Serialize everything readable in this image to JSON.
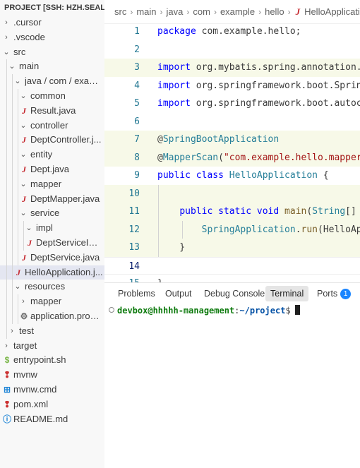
{
  "explorer": {
    "title": "PROJECT [SSH: HZH.SEAL...",
    "items": [
      {
        "label": ".cursor",
        "chevron": "›",
        "depth": 0
      },
      {
        "label": ".vscode",
        "chevron": "›",
        "depth": 0
      },
      {
        "label": "src",
        "chevron": "⌄",
        "depth": 0
      },
      {
        "label": "main",
        "chevron": "⌄",
        "depth": 1
      },
      {
        "label": "java / com / exampl...",
        "chevron": "⌄",
        "depth": 2
      },
      {
        "label": "common",
        "chevron": "⌄",
        "depth": 3
      },
      {
        "label": "Result.java",
        "icon": "J",
        "depth": 3
      },
      {
        "label": "controller",
        "chevron": "⌄",
        "depth": 3
      },
      {
        "label": "DeptController.j...",
        "icon": "J",
        "depth": 3
      },
      {
        "label": "entity",
        "chevron": "⌄",
        "depth": 3
      },
      {
        "label": "Dept.java",
        "icon": "J",
        "depth": 3
      },
      {
        "label": "mapper",
        "chevron": "⌄",
        "depth": 3
      },
      {
        "label": "DeptMapper.java",
        "icon": "J",
        "depth": 3
      },
      {
        "label": "service",
        "chevron": "⌄",
        "depth": 3
      },
      {
        "label": "impl",
        "chevron": "⌄",
        "depth": 4
      },
      {
        "label": "DeptServiceIm...",
        "icon": "J",
        "depth": 4
      },
      {
        "label": "DeptService.java",
        "icon": "J",
        "depth": 3
      },
      {
        "label": "HelloApplication.j...",
        "icon": "J",
        "depth": 2
      },
      {
        "label": "resources",
        "chevron": "⌄",
        "depth": 2
      },
      {
        "label": "mapper",
        "chevron": "›",
        "depth": 3
      },
      {
        "label": "application.prope...",
        "icon": "⚙",
        "depth": 3
      },
      {
        "label": "test",
        "chevron": "›",
        "depth": 1
      },
      {
        "label": "target",
        "chevron": "›",
        "depth": 0
      },
      {
        "label": "entrypoint.sh",
        "icon": "$",
        "depth": 0
      },
      {
        "label": "mvnw",
        "icon": "❢",
        "depth": 0
      },
      {
        "label": "mvnw.cmd",
        "icon": "⊞",
        "depth": 0
      },
      {
        "label": "pom.xml",
        "icon": "❢",
        "depth": 0
      },
      {
        "label": "README.md",
        "icon": "ⓘ",
        "depth": 0
      }
    ]
  },
  "breadcrumb": {
    "parts": [
      "src",
      "main",
      "java",
      "com",
      "example",
      "hello"
    ],
    "file_icon": "J",
    "file": "HelloApplication.java"
  },
  "editor": {
    "lines": [
      {
        "n": "1",
        "tokens": [
          {
            "t": "package",
            "c": "kw"
          },
          {
            "t": " com.example.hello;",
            "c": ""
          }
        ]
      },
      {
        "n": "2",
        "tokens": []
      },
      {
        "n": "3",
        "tokens": [
          {
            "t": "import",
            "c": "kw"
          },
          {
            "t": " org.mybatis.spring.annotation.MapperScan;",
            "c": ""
          }
        ]
      },
      {
        "n": "4",
        "tokens": [
          {
            "t": "import",
            "c": "kw"
          },
          {
            "t": " org.springframework.boot.SpringApplication;",
            "c": ""
          }
        ]
      },
      {
        "n": "5",
        "tokens": [
          {
            "t": "import",
            "c": "kw"
          },
          {
            "t": " org.springframework.boot.autoconfigure.SpringBootApplication;",
            "c": ""
          }
        ]
      },
      {
        "n": "6",
        "tokens": []
      },
      {
        "n": "7",
        "tokens": [
          {
            "t": "@",
            "c": ""
          },
          {
            "t": "SpringBootApplication",
            "c": "an"
          }
        ]
      },
      {
        "n": "8",
        "tokens": [
          {
            "t": "@",
            "c": ""
          },
          {
            "t": "MapperScan",
            "c": "an"
          },
          {
            "t": "(",
            "c": ""
          },
          {
            "t": "\"com.example.hello.mapper\"",
            "c": "str"
          },
          {
            "t": ")",
            "c": ""
          }
        ]
      },
      {
        "n": "9",
        "tokens": [
          {
            "t": "public",
            "c": "kw"
          },
          {
            "t": " ",
            "c": ""
          },
          {
            "t": "class",
            "c": "kw"
          },
          {
            "t": " ",
            "c": ""
          },
          {
            "t": "HelloApplication",
            "c": "ty"
          },
          {
            "t": " {",
            "c": ""
          }
        ]
      },
      {
        "n": "10",
        "tokens": []
      },
      {
        "n": "11",
        "tokens": [
          {
            "t": "    ",
            "c": ""
          },
          {
            "t": "public",
            "c": "kw"
          },
          {
            "t": " ",
            "c": ""
          },
          {
            "t": "static",
            "c": "kw"
          },
          {
            "t": " ",
            "c": ""
          },
          {
            "t": "void",
            "c": "kw"
          },
          {
            "t": " ",
            "c": ""
          },
          {
            "t": "main",
            "c": "fn"
          },
          {
            "t": "(",
            "c": ""
          },
          {
            "t": "String",
            "c": "ty"
          },
          {
            "t": "[] args) {",
            "c": ""
          }
        ]
      },
      {
        "n": "12",
        "tokens": [
          {
            "t": "        ",
            "c": ""
          },
          {
            "t": "SpringApplication",
            "c": "ty"
          },
          {
            "t": ".",
            "c": ""
          },
          {
            "t": "run",
            "c": "fn"
          },
          {
            "t": "(HelloApplication.class, args);",
            "c": ""
          }
        ]
      },
      {
        "n": "13",
        "tokens": [
          {
            "t": "    }",
            "c": ""
          }
        ]
      },
      {
        "n": "14",
        "tokens": []
      },
      {
        "n": "15",
        "tokens": [
          {
            "t": "}",
            "c": ""
          }
        ]
      }
    ]
  },
  "panel": {
    "tabs": [
      {
        "label": "Problems"
      },
      {
        "label": "Output"
      },
      {
        "label": "Debug Console"
      },
      {
        "label": "Terminal"
      },
      {
        "label": "Ports",
        "badge": "1"
      }
    ],
    "active_tab": "Terminal",
    "terminal": {
      "user_host": "devbox@hhhhh-management",
      "colon": ":",
      "path": "~/project",
      "prompt": "$"
    }
  },
  "colors": {
    "accent": "#1a85ff",
    "java_icon": "#c5282f",
    "keyword": "#0000ff",
    "type": "#267f99",
    "string": "#a31515",
    "terminal_user": "#0d7a0d",
    "terminal_path": "#0451a5"
  }
}
